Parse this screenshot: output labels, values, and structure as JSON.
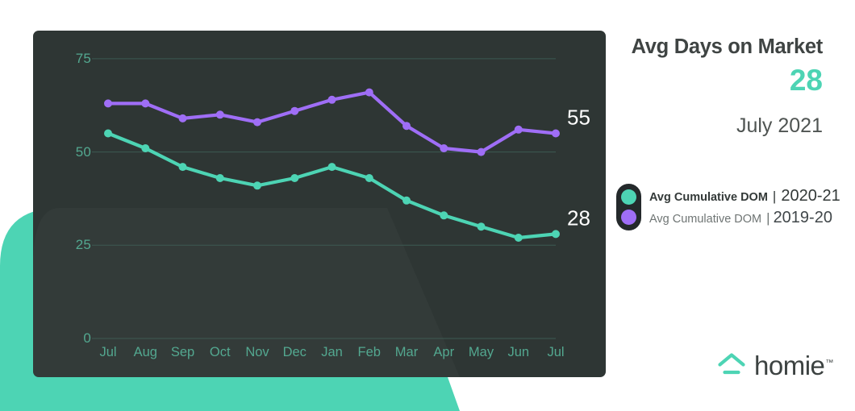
{
  "panel": {
    "title": "Avg Days on Market",
    "value": "28",
    "period": "July 2021"
  },
  "legend": {
    "series": [
      {
        "name": "Avg Cumulative DOM",
        "separator": "|",
        "years": "2020-21",
        "color": "#4dd4b4"
      },
      {
        "name": "Avg Cumulative DOM",
        "separator": "|",
        "years": "2019-20",
        "color": "#9f6ef6"
      }
    ]
  },
  "brand": {
    "name": "homie",
    "trademark": "™",
    "logo_icon": "home-roof-icon",
    "logo_color": "#4dd4b4"
  },
  "end_labels": {
    "teal": "28",
    "purple": "55"
  },
  "colors": {
    "teal": "#4dd4b4",
    "purple": "#9f6ef6",
    "card_background": "#2e3634",
    "grid": "#3c5a52",
    "axis_text": "#53a890",
    "page_background": "#ffffff",
    "blob": "#4dd4b4"
  },
  "chart_data": {
    "type": "line",
    "title": "Avg Days on Market",
    "xlabel": "",
    "ylabel": "",
    "categories": [
      "Jul",
      "Aug",
      "Sep",
      "Oct",
      "Nov",
      "Dec",
      "Jan",
      "Feb",
      "Mar",
      "Apr",
      "May",
      "Jun",
      "Jul"
    ],
    "series": [
      {
        "name": "Avg Cumulative DOM 2020-21",
        "color": "#4dd4b4",
        "values": [
          55,
          51,
          46,
          43,
          41,
          43,
          46,
          43,
          37,
          33,
          30,
          27,
          28
        ],
        "end_label": "28"
      },
      {
        "name": "Avg Cumulative DOM 2019-20",
        "color": "#9f6ef6",
        "values": [
          63,
          63,
          59,
          60,
          58,
          61,
          64,
          66,
          57,
          51,
          50,
          56,
          55
        ],
        "end_label": "55"
      }
    ],
    "ylim": [
      0,
      80
    ],
    "yticks": [
      0,
      25,
      50,
      75
    ],
    "ytick_labels": [
      "0",
      "25",
      "50",
      "75"
    ],
    "grid": true,
    "grid_axis": "y",
    "legend_position": "right"
  }
}
